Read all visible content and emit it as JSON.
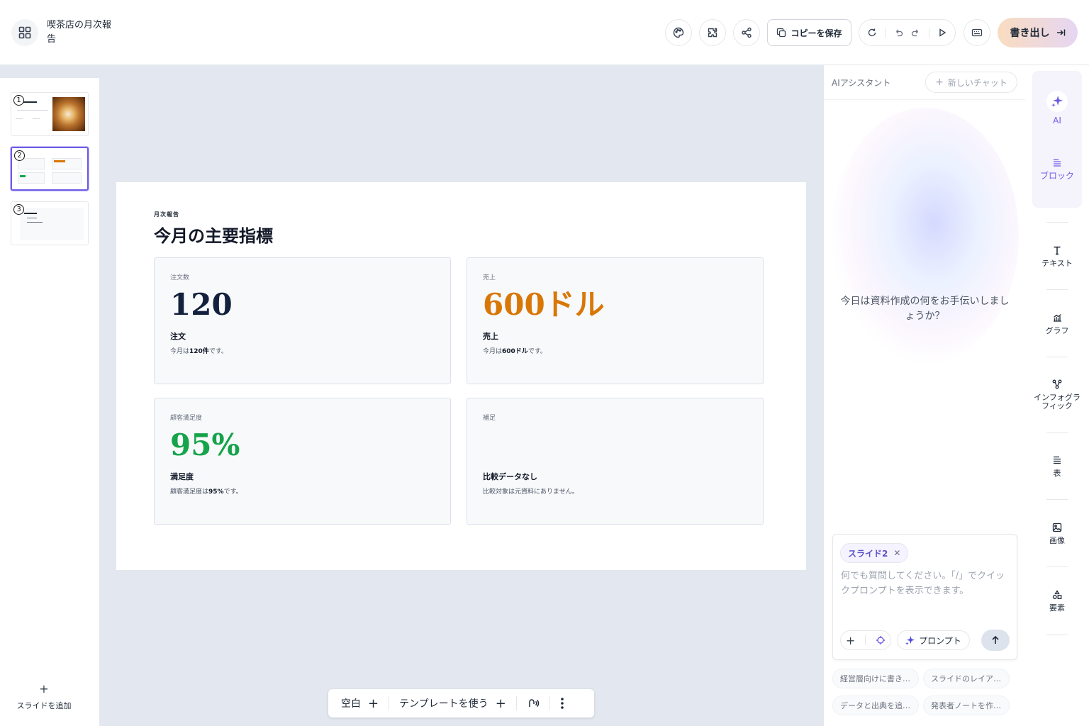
{
  "header": {
    "doc_title": "喫茶店の月次報告",
    "copy_label": "コピーを保存",
    "export_label": "書き出し"
  },
  "slides_panel": {
    "thumbs": [
      {
        "num": "1"
      },
      {
        "num": "2"
      },
      {
        "num": "3"
      }
    ],
    "add_label": "スライドを追加"
  },
  "slide": {
    "kicker": "月次報告",
    "title": "今月の主要指標",
    "cards": [
      {
        "label": "注文数",
        "value": "120",
        "value_color": "#14213d",
        "title": "注文",
        "desc_pre": "今月は",
        "desc_bold": "120件",
        "desc_post": "です。"
      },
      {
        "label": "売上",
        "value": "600ドル",
        "value_color": "#d97706",
        "title": "売上",
        "desc_pre": "今月は",
        "desc_bold": "600ドル",
        "desc_post": "です。"
      },
      {
        "label": "顧客満足度",
        "value": "95%",
        "value_color": "#16a34a",
        "title": "満足度",
        "desc_pre": "顧客満足度は",
        "desc_bold": "95%",
        "desc_post": "です。"
      },
      {
        "label": "補足",
        "value": "",
        "value_color": "#14213d",
        "title": "比較データなし",
        "desc_pre": "比較対象は元資料にありません。",
        "desc_bold": "",
        "desc_post": ""
      }
    ]
  },
  "bottom_bar": {
    "blank_label": "空白",
    "template_label": "テンプレートを使う"
  },
  "ai": {
    "header_label": "AIアシスタント",
    "new_chat_label": "新しいチャット",
    "greeting": "今日は資料作成の何をお手伝いしましょうか？",
    "chip_label": "スライド2",
    "placeholder": "何でも質問してください。「/」でクイックプロンプトを表示できます。",
    "prompt_label": "プロンプト",
    "suggestions": [
      "経営層向けに書き…",
      "スライドのレイア…",
      "データと出典を追…",
      "発表者ノートを作…"
    ]
  },
  "rail": {
    "ai_label": "AI",
    "block_label": "ブロック",
    "text_label": "テキスト",
    "graph_label": "グラフ",
    "infographic_label": "インフォグラフィック",
    "table_label": "表",
    "image_label": "画像",
    "element_label": "要素"
  },
  "colors": {
    "accent": "#6d5ce8",
    "orange": "#d97706",
    "green": "#16a34a",
    "navy": "#14213d"
  }
}
